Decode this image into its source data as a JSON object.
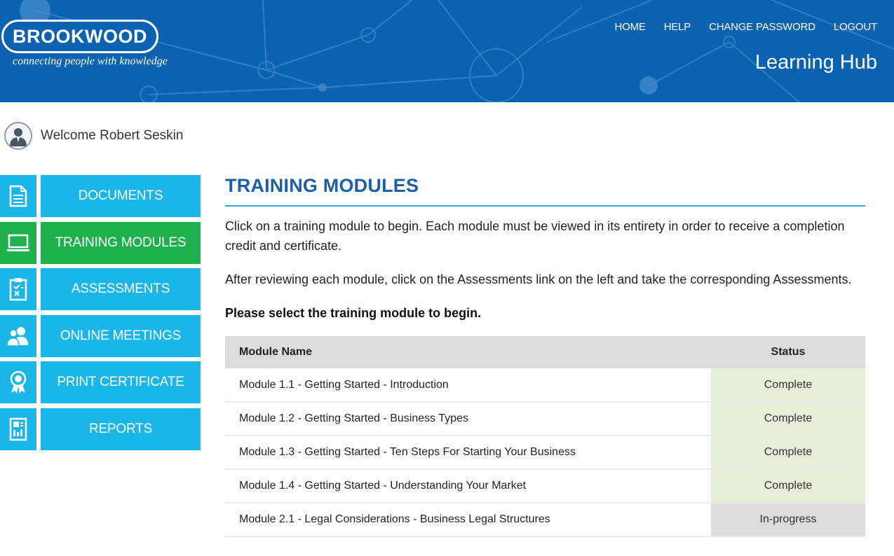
{
  "header": {
    "logo": "BROOKWOOD",
    "tagline": "connecting people with knowledge",
    "nav": [
      "HOME",
      "HELP",
      "CHANGE PASSWORD",
      "LOGOUT"
    ],
    "hub_title": "Learning Hub"
  },
  "welcome": {
    "text": "Welcome Robert Seskin",
    "icon": "user-avatar-icon"
  },
  "sidebar": {
    "items": [
      {
        "label": "DOCUMENTS",
        "icon": "document-icon",
        "active": false
      },
      {
        "label": "TRAINING MODULES",
        "icon": "laptop-icon",
        "active": true
      },
      {
        "label": "ASSESSMENTS",
        "icon": "checklist-icon",
        "active": false
      },
      {
        "label": "ONLINE MEETINGS",
        "icon": "people-icon",
        "active": false
      },
      {
        "label": "PRINT CERTIFICATE",
        "icon": "award-ribbon-icon",
        "active": false
      },
      {
        "label": "REPORTS",
        "icon": "report-icon",
        "active": false
      }
    ]
  },
  "main": {
    "title": "TRAINING MODULES",
    "para1": "Click on a training module to begin. Each module must be viewed in its entirety in order to receive a completion credit and certificate.",
    "para2": "After reviewing each module, click on the Assessments link on the left and take the corresponding Assessments.",
    "prompt": "Please select the training module to begin.",
    "table": {
      "headers": [
        "Module Name",
        "Status"
      ],
      "rows": [
        {
          "name": "Module 1.1 - Getting Started - Introduction",
          "status": "Complete"
        },
        {
          "name": "Module 1.2 - Getting Started - Business Types",
          "status": "Complete"
        },
        {
          "name": "Module 1.3 - Getting Started - Ten Steps For Starting Your Business",
          "status": "Complete"
        },
        {
          "name": "Module 1.4 - Getting Started - Understanding Your Market",
          "status": "Complete"
        },
        {
          "name": "Module 2.1 - Legal Considerations - Business Legal Structures",
          "status": "In-progress"
        }
      ]
    }
  },
  "colors": {
    "header_blue": "#0b62b0",
    "sidebar_blue": "#1bb6e8",
    "active_green": "#1fb04d",
    "title_blue": "#1a5fa8",
    "complete_bg": "#e8efd9",
    "inprogress_bg": "#dcdcdc"
  }
}
